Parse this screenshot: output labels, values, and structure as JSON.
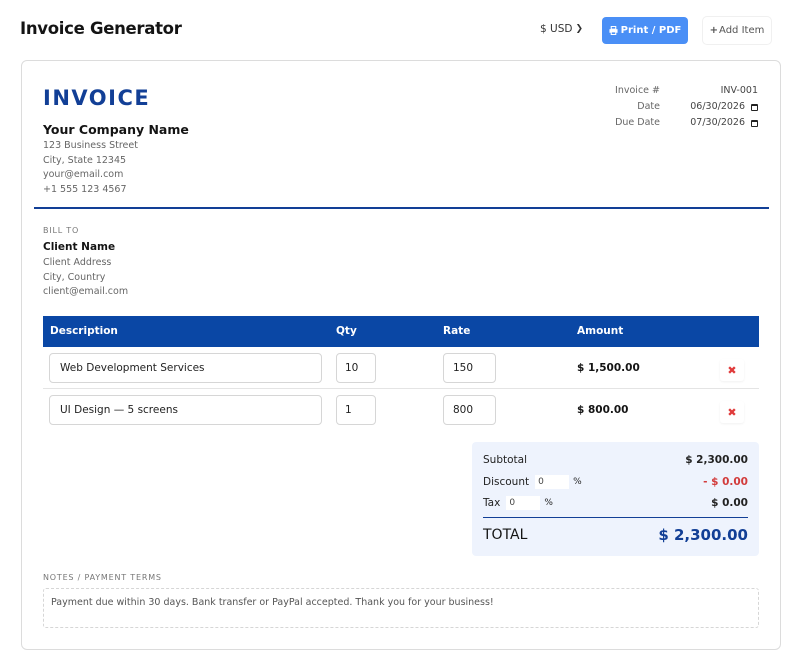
{
  "header": {
    "app_title": "Invoice Generator",
    "currency": "$ USD",
    "print_label": "Print / PDF",
    "add_item_label": "Add Item"
  },
  "invoice": {
    "title": "INVOICE",
    "company": {
      "name": "Your Company Name",
      "street": "123 Business Street",
      "city": "City, State 12345",
      "email": "your@email.com",
      "phone": "+1 555 123 4567"
    },
    "meta": {
      "number_label": "Invoice #",
      "number_value": "INV-001",
      "date_label": "Date",
      "date_value": "06/30/2026",
      "due_label": "Due Date",
      "due_value": "07/30/2026"
    },
    "bill_to": {
      "label": "BILL TO",
      "name": "Client Name",
      "address": "Client Address",
      "city": "City, Country",
      "email": "client@email.com"
    },
    "table": {
      "headers": [
        "Description",
        "Qty",
        "Rate",
        "Amount"
      ],
      "rows": [
        {
          "description": "Web Development Services",
          "qty": "10",
          "rate": "150",
          "amount": "$ 1,500.00"
        },
        {
          "description": "UI Design — 5 screens",
          "qty": "1",
          "rate": "800",
          "amount": "$ 800.00"
        }
      ]
    },
    "totals": {
      "subtotal_label": "Subtotal",
      "subtotal_value": "$ 2,300.00",
      "discount_label": "Discount",
      "discount_pct": "0",
      "discount_value": "- $ 0.00",
      "tax_label": "Tax",
      "tax_pct": "0",
      "tax_value": "$ 0.00",
      "percent_sign": "%",
      "total_label": "TOTAL",
      "total_value": "$ 2,300.00"
    },
    "notes": {
      "label": "NOTES / PAYMENT TERMS",
      "text": "Payment due within 30 days. Bank transfer or PayPal accepted. Thank you for your business!"
    }
  },
  "icons": {
    "currency_dropdown": "chevron-down-icon",
    "print": "printer-icon",
    "add": "plus-icon",
    "calendar": "calendar-icon",
    "remove": "close-icon"
  },
  "colors": {
    "accent": "#123f96",
    "table_header": "#0a47a5",
    "print_button": "#4a8ff6",
    "totals_bg": "#eef3fd",
    "danger": "#e03a3a"
  }
}
